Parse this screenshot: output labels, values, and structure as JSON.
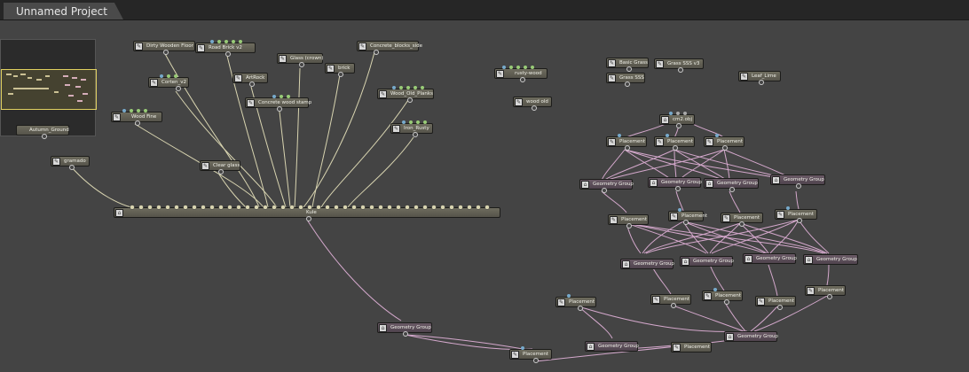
{
  "tab": {
    "title": "Unnamed Project"
  },
  "nodes": {
    "dirty_wooden_floor": "Dirty Wooden Floor",
    "road_brick": "Road Brick v2",
    "glass_crown": "Glass (crown)",
    "concrete_blocks": "Concrete_blocks_side",
    "corten": "Corten_v2",
    "artrock": "ArtRock",
    "brick": "brick",
    "concrete_wood": "Concrete wood stamp",
    "wood_old_planks": "Wood_Old_Planks",
    "wood_fine": "Wood Fine",
    "iron_rusty": "Iron_Rusty",
    "autumn_ground": "Autumn_Ground",
    "gramado": "gramado",
    "clear_glass": "Clear glass",
    "kule": "Kule",
    "rusty_wood": "rusty-wood",
    "wood_old": "wood old",
    "basic_grass": "Basic Grass",
    "grass_sss_v3": "Grass SSS v3",
    "grass_sss": "Grass SSS",
    "leaf_lime": "Leaf_Lime",
    "obj": "cm2.obj",
    "placement": "Placement",
    "geometry_group": "Geometry Group"
  }
}
